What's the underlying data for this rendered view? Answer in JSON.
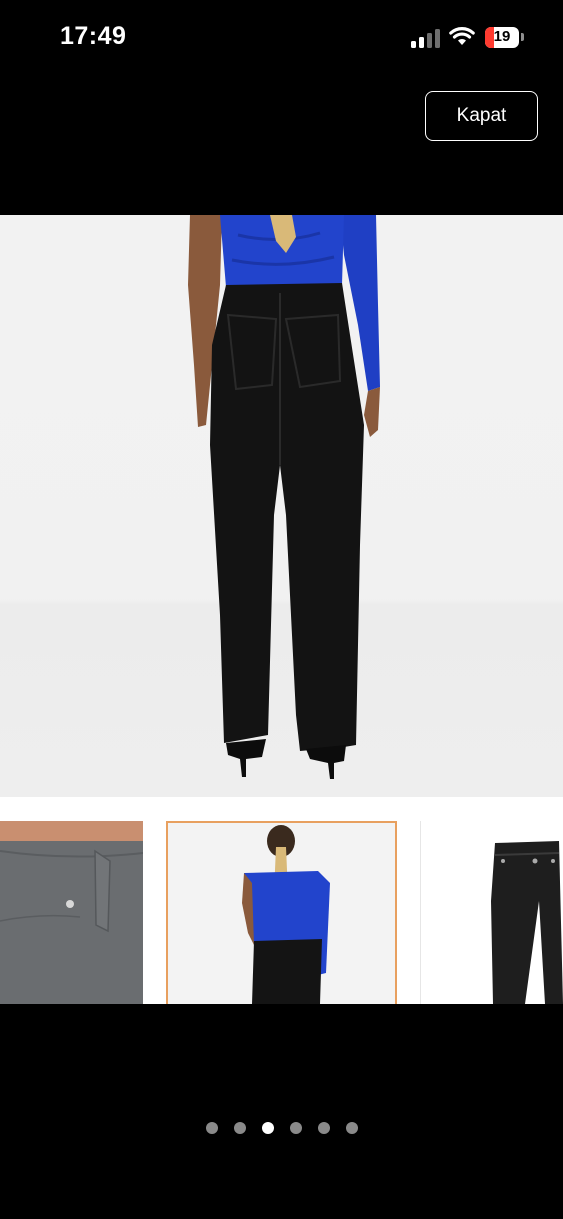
{
  "status_bar": {
    "time": "17:49",
    "battery_level": "19",
    "icons": [
      "cellular-signal-icon",
      "wifi-icon",
      "battery-icon"
    ]
  },
  "header": {
    "close_label": "Kapat"
  },
  "gallery": {
    "total_images": 6,
    "active_index": 2,
    "thumbnails": [
      "jeans-pocket-closeup",
      "model-back-view",
      "jeans-front-view"
    ]
  },
  "colors": {
    "background": "#000000",
    "top": "#1f3fc4",
    "jeans": "#111111",
    "thumbnail_highlight": "#e8a05f",
    "battery_low": "#ff3b30"
  }
}
